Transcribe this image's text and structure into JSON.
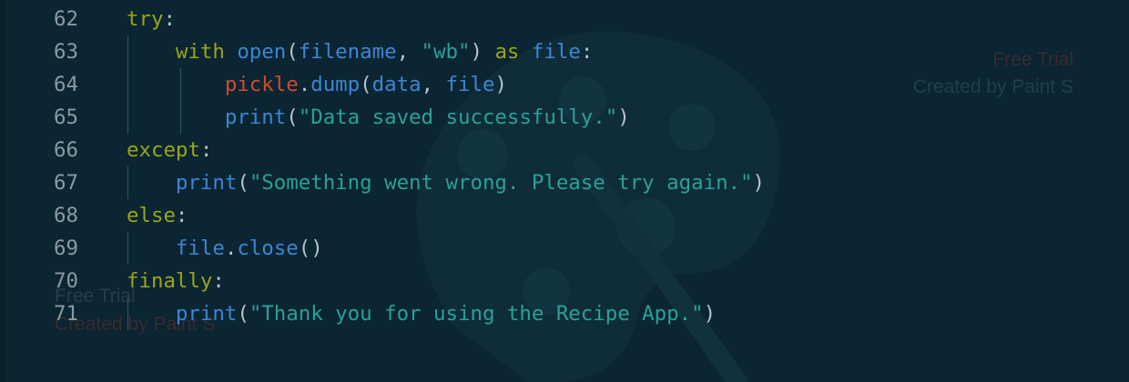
{
  "watermark": {
    "free_trial": "Free Trial",
    "created_by": "Created by Paint S"
  },
  "colors": {
    "background": "#0b2532",
    "keyword": "#9aa519",
    "function": "#3c86d4",
    "module": "#d44a2c",
    "string": "#2aa198",
    "line_number": "#8b9aa3",
    "punctuation": "#b7c2c8"
  },
  "code": {
    "lines": [
      {
        "number": "62",
        "tokens": [
          {
            "t": "try",
            "k": "kw"
          },
          {
            "t": ":",
            "k": "pu"
          }
        ]
      },
      {
        "number": "63",
        "tokens": [
          {
            "t": "    ",
            "k": "pu"
          },
          {
            "t": "with",
            "k": "kw"
          },
          {
            "t": " ",
            "k": "pu"
          },
          {
            "t": "open",
            "k": "fn"
          },
          {
            "t": "(",
            "k": "pu"
          },
          {
            "t": "filename",
            "k": "var"
          },
          {
            "t": ", ",
            "k": "pu"
          },
          {
            "t": "\"wb\"",
            "k": "str"
          },
          {
            "t": ") ",
            "k": "pu"
          },
          {
            "t": "as",
            "k": "kw"
          },
          {
            "t": " ",
            "k": "pu"
          },
          {
            "t": "file",
            "k": "var"
          },
          {
            "t": ":",
            "k": "pu"
          }
        ]
      },
      {
        "number": "64",
        "tokens": [
          {
            "t": "        ",
            "k": "pu"
          },
          {
            "t": "pickle",
            "k": "mod"
          },
          {
            "t": ".",
            "k": "pu"
          },
          {
            "t": "dump",
            "k": "fn"
          },
          {
            "t": "(",
            "k": "pu"
          },
          {
            "t": "data",
            "k": "var"
          },
          {
            "t": ", ",
            "k": "pu"
          },
          {
            "t": "file",
            "k": "var"
          },
          {
            "t": ")",
            "k": "pu"
          }
        ]
      },
      {
        "number": "65",
        "tokens": [
          {
            "t": "        ",
            "k": "pu"
          },
          {
            "t": "print",
            "k": "fn"
          },
          {
            "t": "(",
            "k": "pu"
          },
          {
            "t": "\"Data saved successfully.\"",
            "k": "str"
          },
          {
            "t": ")",
            "k": "pu"
          }
        ]
      },
      {
        "number": "66",
        "tokens": [
          {
            "t": "except",
            "k": "kw"
          },
          {
            "t": ":",
            "k": "pu"
          }
        ]
      },
      {
        "number": "67",
        "tokens": [
          {
            "t": "    ",
            "k": "pu"
          },
          {
            "t": "print",
            "k": "fn"
          },
          {
            "t": "(",
            "k": "pu"
          },
          {
            "t": "\"Something went wrong. Please try again.\"",
            "k": "str"
          },
          {
            "t": ")",
            "k": "pu"
          }
        ]
      },
      {
        "number": "68",
        "tokens": [
          {
            "t": "else",
            "k": "kw"
          },
          {
            "t": ":",
            "k": "pu"
          }
        ]
      },
      {
        "number": "69",
        "tokens": [
          {
            "t": "    ",
            "k": "pu"
          },
          {
            "t": "file",
            "k": "var"
          },
          {
            "t": ".",
            "k": "pu"
          },
          {
            "t": "close",
            "k": "fn"
          },
          {
            "t": "()",
            "k": "pu"
          }
        ]
      },
      {
        "number": "70",
        "tokens": [
          {
            "t": "finally",
            "k": "kw"
          },
          {
            "t": ":",
            "k": "pu"
          }
        ]
      },
      {
        "number": "71",
        "tokens": [
          {
            "t": "    ",
            "k": "pu"
          },
          {
            "t": "print",
            "k": "fn"
          },
          {
            "t": "(",
            "k": "pu"
          },
          {
            "t": "\"Thank you for using the Recipe App.\"",
            "k": "str"
          },
          {
            "t": ")",
            "k": "pu"
          }
        ]
      }
    ]
  }
}
